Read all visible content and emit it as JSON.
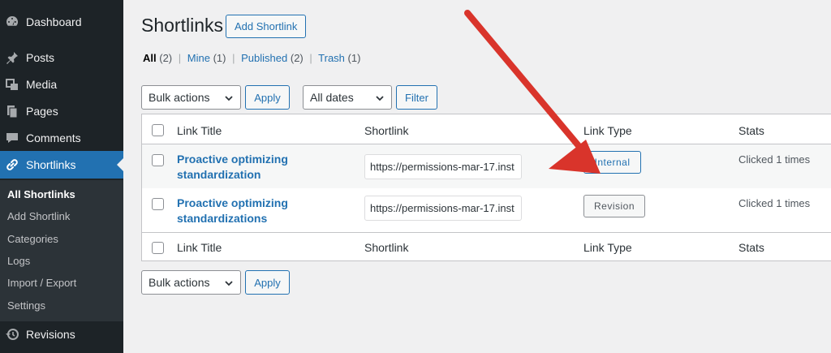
{
  "sidebar": {
    "items": [
      {
        "label": "Dashboard",
        "icon": "dashboard-icon"
      },
      {
        "label": "Posts",
        "icon": "pin-icon"
      },
      {
        "label": "Media",
        "icon": "media-icon"
      },
      {
        "label": "Pages",
        "icon": "pages-icon"
      },
      {
        "label": "Comments",
        "icon": "comment-icon"
      },
      {
        "label": "Shortlinks",
        "icon": "link-icon"
      },
      {
        "label": "Revisions",
        "icon": "history-icon"
      }
    ],
    "submenu": [
      "All Shortlinks",
      "Add Shortlink",
      "Categories",
      "Logs",
      "Import / Export",
      "Settings"
    ]
  },
  "header": {
    "title": "Shortlinks",
    "add_button": "Add Shortlink"
  },
  "views": {
    "all": "All",
    "all_count": "(2)",
    "mine": "Mine",
    "mine_count": "(1)",
    "published": "Published",
    "published_count": "(2)",
    "trash": "Trash",
    "trash_count": "(1)",
    "sep": "|"
  },
  "controls": {
    "bulk_actions": "Bulk actions",
    "apply": "Apply",
    "dates": "All dates",
    "filter": "Filter"
  },
  "table": {
    "columns": [
      "Link Title",
      "Shortlink",
      "Link Type",
      "Stats"
    ],
    "rows": [
      {
        "title_line1": "Proactive optimizing",
        "title_line2": "standardization",
        "shortlink": "https://permissions-mar-17.inst",
        "type": "Internal",
        "stats": "Clicked 1 times"
      },
      {
        "title_line1": "Proactive optimizing",
        "title_line2": "standardizations",
        "shortlink": "https://permissions-mar-17.inst",
        "type": "Revision",
        "stats": "Clicked 1 times"
      }
    ]
  },
  "colors": {
    "accent": "#2271b1",
    "sidebar": "#1d2327",
    "arrow": "#d9342b"
  }
}
